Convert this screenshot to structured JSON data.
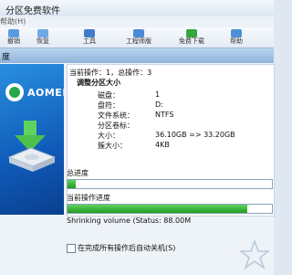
{
  "background_window": {
    "title": "分区免费软件",
    "menu_text": "帮助(H)",
    "toolbar": [
      {
        "label": "撤销",
        "icon": "undo-icon"
      },
      {
        "label": "恢复",
        "icon": "redo-icon"
      },
      {
        "label": "工具",
        "icon": "tools-icon"
      },
      {
        "label": "工程师版",
        "icon": "engineer-icon"
      },
      {
        "label": "免费下载",
        "icon": "download-icon"
      },
      {
        "label": "帮助",
        "icon": "help-icon"
      }
    ]
  },
  "dialog": {
    "title": "度",
    "brand": "AOMEI",
    "current_op": "当前操作：1，总操作：3",
    "section_title": "调整分区大小",
    "details": [
      {
        "key": "磁盘：",
        "value": "1"
      },
      {
        "key": "盘符：",
        "value": "D:"
      },
      {
        "key": "文件系统：",
        "value": "NTFS"
      },
      {
        "key": "分区卷标：",
        "value": ""
      },
      {
        "key": "大小：",
        "value": "36.10GB => 33.20GB"
      },
      {
        "key": "簇大小：",
        "value": "4KB"
      }
    ],
    "total_progress_label": "总进度",
    "total_progress": 0.04,
    "current_progress_label": "当前操作进度",
    "current_progress": 0.88,
    "status_text": "Shrinking volume (Status: 88.00M",
    "shutdown_checkbox_label": "在完成所有操作后自动关机(S)",
    "shutdown_checked": false
  },
  "colors": {
    "banner": "#1470d0",
    "progress_fill": "#2bb02b"
  }
}
